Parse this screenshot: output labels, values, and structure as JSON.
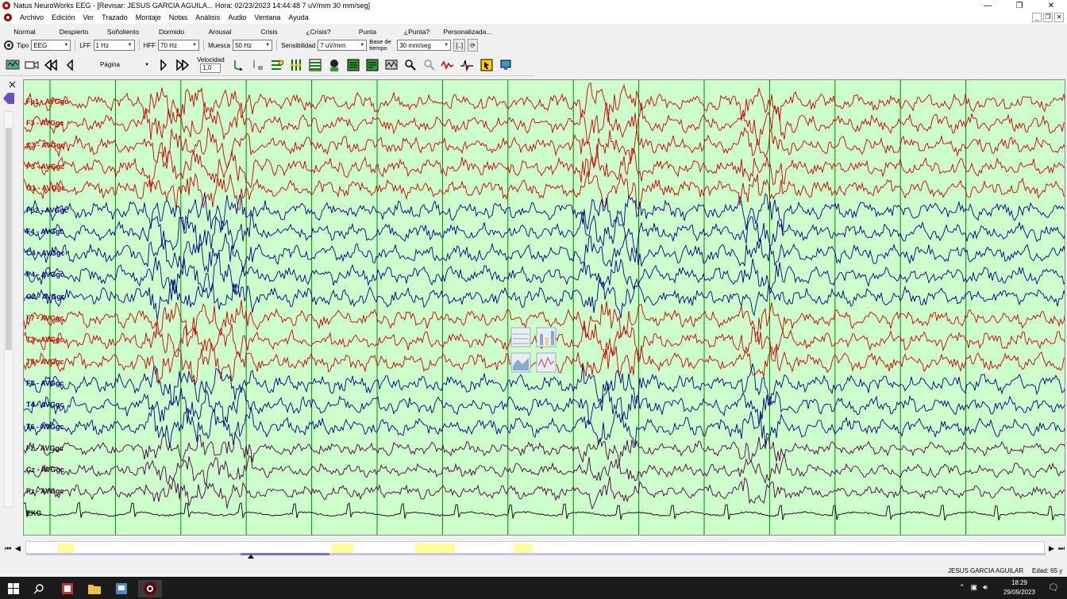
{
  "window": {
    "title": "Natus NeuroWorks EEG - [Revisar:   JESUS  GARCIA AGUILA...   Hora: 02/23/2023 14:44:48   7 uV/mm   30 mm/seg]",
    "minimize": "—",
    "restore": "❐",
    "close": "✕"
  },
  "menu": [
    "Archivo",
    "Edición",
    "Ver",
    "Trazado",
    "Montaje",
    "Notas",
    "Análisis",
    "Audio",
    "Ventana",
    "Ayuda"
  ],
  "events": [
    "Normal",
    "Despierto",
    "Soñoliento",
    "Dormido",
    "Arousal",
    "Crisis",
    "¿Crisis?",
    "Punta",
    "¿Punta?",
    "Personalizada..."
  ],
  "controls": {
    "tipo_label": "Tipo",
    "tipo_value": "EEG",
    "lff_label": "LFF",
    "lff_value": "1 Hz",
    "hff_label": "HFF",
    "hff_value": "70 Hz",
    "notch_label": "Muesca",
    "notch_value": "50 Hz",
    "sens_label": "Sensibilidad",
    "sens_value": "7 uV/mm",
    "timebase_label": "Base de tiempo",
    "timebase_value": "30 mm/seg",
    "bracket_btn": "[..]"
  },
  "playback": {
    "page_label": "Página",
    "speed_label": "Velocidad",
    "speed_value": "1,0"
  },
  "channels": [
    {
      "label": "Fp1 - AVGgc",
      "color": "#cc0000"
    },
    {
      "label": "F3 - AVGgc",
      "color": "#cc0000"
    },
    {
      "label": "C3 - AVGgc",
      "color": "#cc0000"
    },
    {
      "label": "P3 - AVGgc",
      "color": "#cc0000"
    },
    {
      "label": "O1 - AVGgc",
      "color": "#cc0000"
    },
    {
      "label": "Fp2 - AVGgc",
      "color": "#000080"
    },
    {
      "label": "F4 - AVGgc",
      "color": "#000080"
    },
    {
      "label": "C4 - AVGgc",
      "color": "#000080"
    },
    {
      "label": "P4 - AVGgc",
      "color": "#000080"
    },
    {
      "label": "O2 - AVGgc",
      "color": "#000080"
    },
    {
      "label": "F7 - AVGgc",
      "color": "#cc0000"
    },
    {
      "label": "T3 - AVGgc",
      "color": "#cc0000"
    },
    {
      "label": "T5 - AVGgc",
      "color": "#cc0000"
    },
    {
      "label": "F8 - AVGgc",
      "color": "#000080"
    },
    {
      "label": "T4 - AVGgc",
      "color": "#000080"
    },
    {
      "label": "T6 - AVGgc",
      "color": "#000080"
    },
    {
      "label": "Fz - AVGgc",
      "color": "#4b0040"
    },
    {
      "label": "Cz - AVGgc",
      "color": "#4b0040"
    },
    {
      "label": "Pz - AVGgc",
      "color": "#4b0040"
    },
    {
      "label": "EKG",
      "color": "#000000"
    }
  ],
  "eeg_background": "#ccffcc",
  "status": {
    "patient": "JESUS  GARCIA AGUILAR",
    "age": "Edad: 65 y"
  },
  "taskbar": {
    "time": "18:29",
    "date": "29/09/2023"
  }
}
